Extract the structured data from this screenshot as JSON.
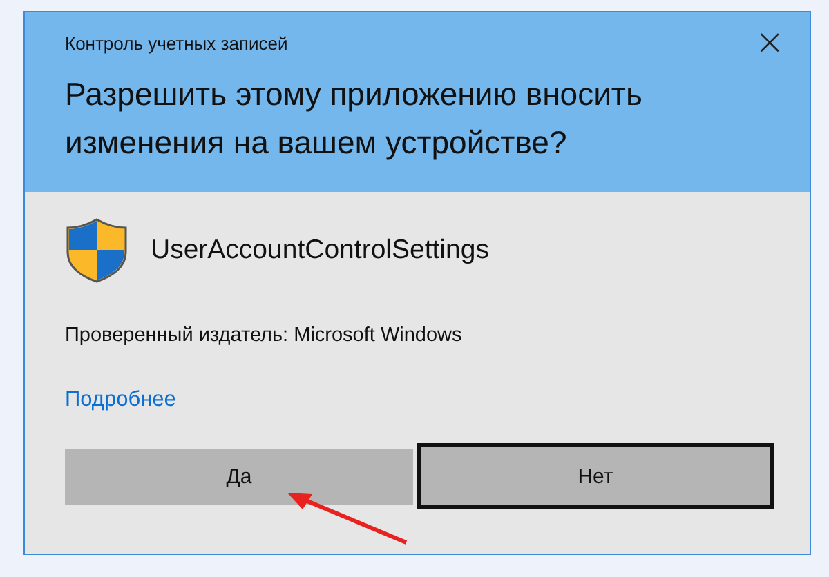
{
  "window": {
    "title": "Контроль учетных записей",
    "close": "×"
  },
  "heading": "Разрешить этому приложению вносить изменения на вашем устройстве?",
  "app_name": "UserAccountControlSettings",
  "publisher": "Проверенный издатель: Microsoft Windows",
  "details_link": "Подробнее",
  "buttons": [
    {
      "label": "Да",
      "focused": false
    },
    {
      "label": "Нет",
      "focused": true
    }
  ],
  "annotation": {
    "kind": "arrow"
  }
}
